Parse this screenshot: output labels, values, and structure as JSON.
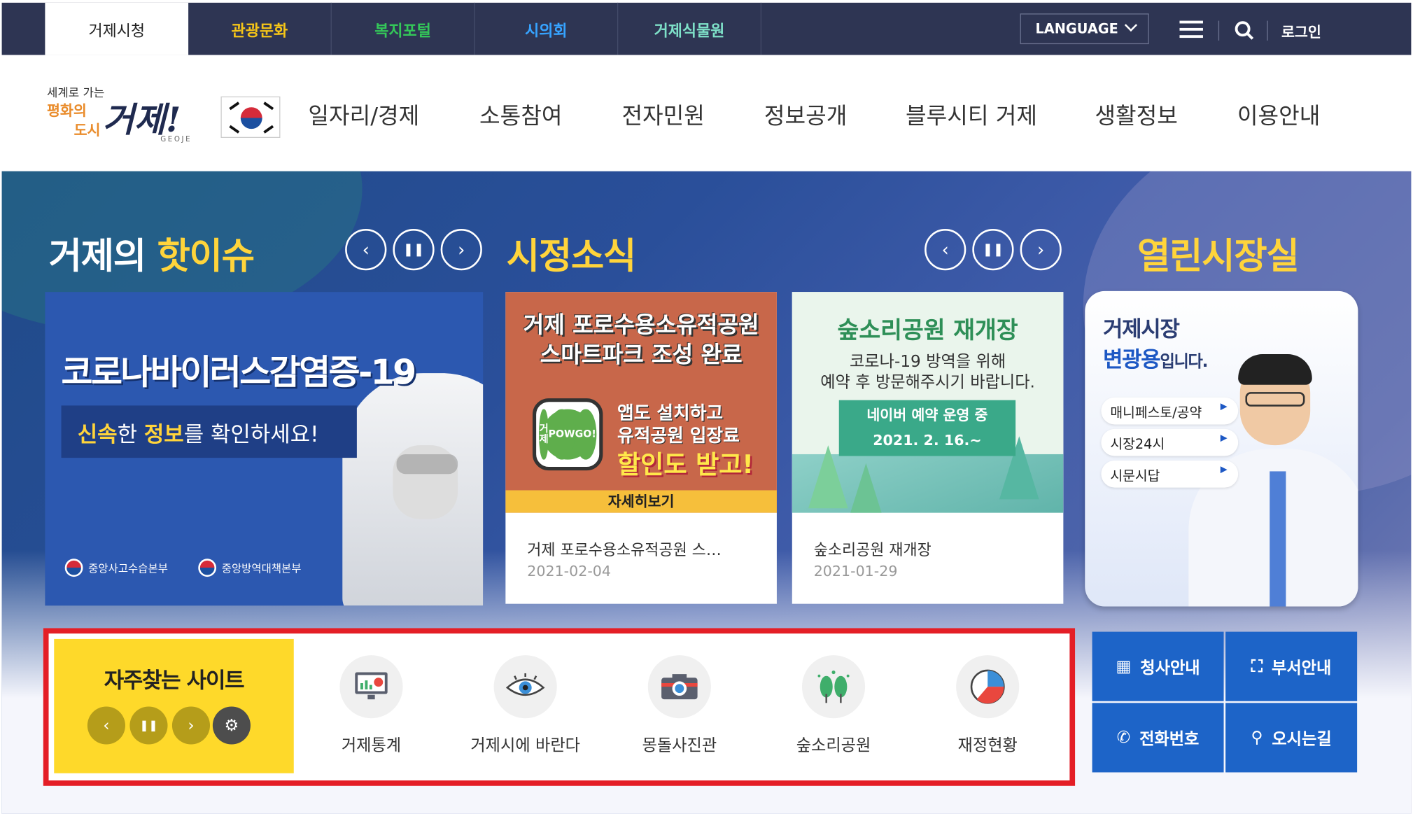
{
  "topbar": {
    "tabs": [
      {
        "label": "거제시청",
        "color": "#222222"
      },
      {
        "label": "관광문화",
        "color": "#f5c518"
      },
      {
        "label": "복지포털",
        "color": "#34c759"
      },
      {
        "label": "시의회",
        "color": "#36a3ff"
      },
      {
        "label": "거제식물원",
        "color": "#7ee0c8"
      }
    ],
    "language": "LANGUAGE",
    "login": "로그인",
    "background": "#2e3553"
  },
  "logo": {
    "line1": "세계로 가는",
    "line2a": "평화의",
    "line2b": "도시",
    "main": "거제!",
    "sub": "GEOJE"
  },
  "gnb": [
    "일자리/경제",
    "소통참여",
    "전자민원",
    "정보공개",
    "블루시티 거제",
    "생활정보",
    "이용안내"
  ],
  "hot_issue": {
    "title_a": "거제의 ",
    "title_b": "핫이슈",
    "banner_head": "코로나바이러스감염증-19",
    "banner_sub_a": "신속",
    "banner_sub_b": "한 ",
    "banner_sub_c": "정보",
    "banner_sub_d": "를 확인하세요!",
    "org1": "중앙사고수습본부",
    "org2": "중앙방역대책본부"
  },
  "city_news": {
    "title": "시정소식",
    "cards": [
      {
        "img_line1": "거제 포로수용소유적공원",
        "img_line2": "스마트파크 조성 완료",
        "badge_line1": "거제",
        "badge_line2": "POW",
        "badge_line3": "GO!",
        "promo1": "앱도 설치하고",
        "promo2": "유적공원 입장료",
        "promo3": "할인도 받고!",
        "more": "자세히보기",
        "caption": "거제 포로수용소유적공원 스…",
        "date": "2021-02-04"
      },
      {
        "img_line1": "숲소리공원 재개장",
        "img_line2": "코로나-19 방역을 위해",
        "img_line3": "예약 후 방문해주시기 바랍니다.",
        "pill1": "네이버 예약 운영 중",
        "pill2": "2021. 2. 16.~",
        "caption": "숲소리공원 재개장",
        "date": "2021-01-29"
      }
    ]
  },
  "open_mayor": {
    "title": "열린시장실",
    "line1": "거제시장",
    "name": "변광용",
    "suffix": "입니다.",
    "links": [
      "매니페스토/공약",
      "시장24시",
      "시문시답"
    ]
  },
  "quick": {
    "title": "자주찾는 사이트",
    "items": [
      {
        "label": "거제통계",
        "icon": "monitor-chart-icon"
      },
      {
        "label": "거제시에 바란다",
        "icon": "eye-icon"
      },
      {
        "label": "몽돌사진관",
        "icon": "camera-icon"
      },
      {
        "label": "숲소리공원",
        "icon": "trees-icon"
      },
      {
        "label": "재정현황",
        "icon": "pie-chart-icon"
      }
    ],
    "highlight_color": "#e41e26",
    "accent": "#fed92a"
  },
  "info_links": [
    {
      "label": "청사안내",
      "icon": "building-icon"
    },
    {
      "label": "부서안내",
      "icon": "org-chart-icon"
    },
    {
      "label": "전화번호",
      "icon": "phone-icon"
    },
    {
      "label": "오시는길",
      "icon": "location-icon"
    }
  ]
}
